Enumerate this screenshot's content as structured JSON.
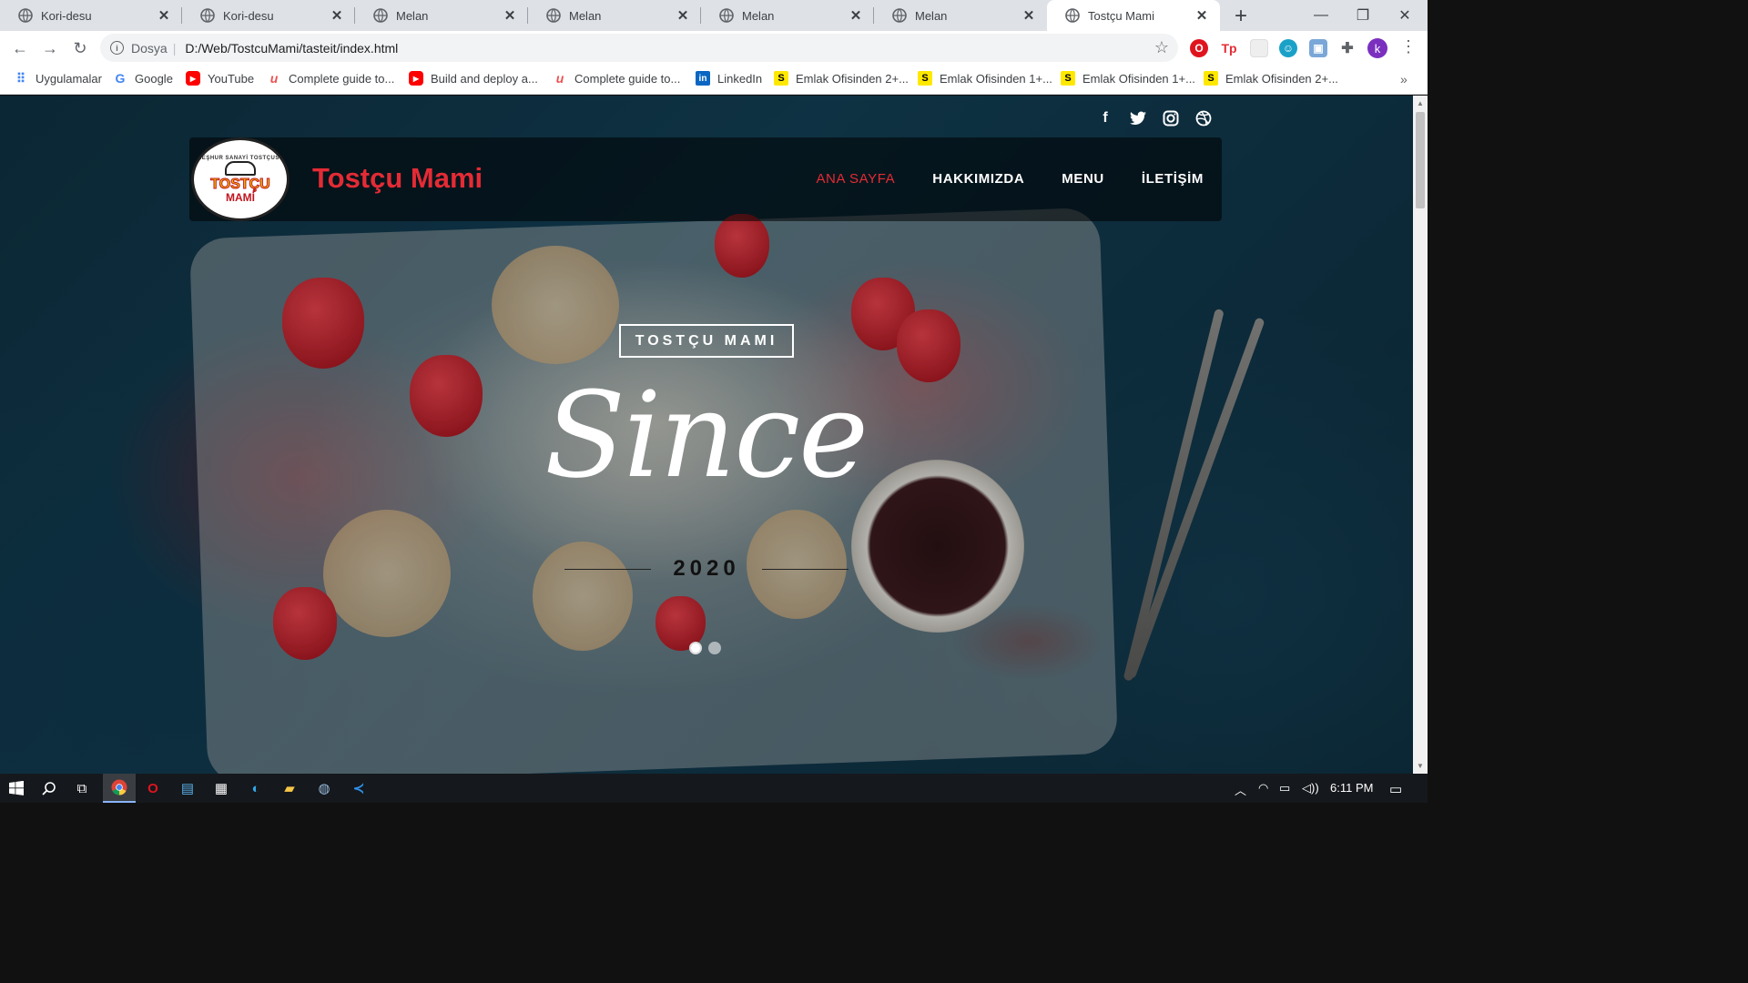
{
  "browser": {
    "tabs": [
      {
        "label": "Kori-desu",
        "active": false
      },
      {
        "label": "Kori-desu",
        "active": false
      },
      {
        "label": "Melan",
        "active": false
      },
      {
        "label": "Melan",
        "active": false
      },
      {
        "label": "Melan",
        "active": false
      },
      {
        "label": "Melan",
        "active": false
      },
      {
        "label": "Tostçu Mami",
        "active": true
      }
    ],
    "address": {
      "scheme": "Dosya",
      "url": "D:/Web/TostcuMami/tasteit/index.html"
    },
    "bookmarks": [
      {
        "label": "Uygulamalar",
        "icon": "apps-grid-icon"
      },
      {
        "label": "Google",
        "icon": "google-icon"
      },
      {
        "label": "YouTube",
        "icon": "youtube-icon"
      },
      {
        "label": "Complete guide to...",
        "icon": "udemy-icon"
      },
      {
        "label": "Build and deploy a...",
        "icon": "youtube-icon"
      },
      {
        "label": "Complete guide to...",
        "icon": "udemy-icon"
      },
      {
        "label": "LinkedIn",
        "icon": "linkedin-icon"
      },
      {
        "label": "Emlak Ofisinden 2+...",
        "icon": "sahibinden-icon"
      },
      {
        "label": "Emlak Ofisinden 1+...",
        "icon": "sahibinden-icon"
      },
      {
        "label": "Emlak Ofisinden 1+...",
        "icon": "sahibinden-icon"
      },
      {
        "label": "Emlak Ofisinden 2+...",
        "icon": "sahibinden-icon"
      }
    ],
    "profile_initial": "k"
  },
  "site": {
    "brand": "Tostçu Mami",
    "logo": {
      "arc_text": "MEŞHUR SANAYİ TOSTÇUSU",
      "word1": "TOSTÇU",
      "word2": "MAMİ"
    },
    "nav": [
      {
        "label": "ANA SAYFA",
        "active": true
      },
      {
        "label": "HAKKIMIZDA",
        "active": false
      },
      {
        "label": "MENU",
        "active": false
      },
      {
        "label": "İLETİŞİM",
        "active": false
      }
    ],
    "social": [
      "facebook-icon",
      "twitter-icon",
      "instagram-icon",
      "dribbble-icon"
    ],
    "hero": {
      "tag": "TOSTÇU MAMI",
      "script": "Since",
      "year": "2020"
    },
    "slider": {
      "count": 2,
      "active": 0
    },
    "colors": {
      "accent": "#e42b35"
    }
  },
  "taskbar": {
    "time": "6:11 PM"
  }
}
